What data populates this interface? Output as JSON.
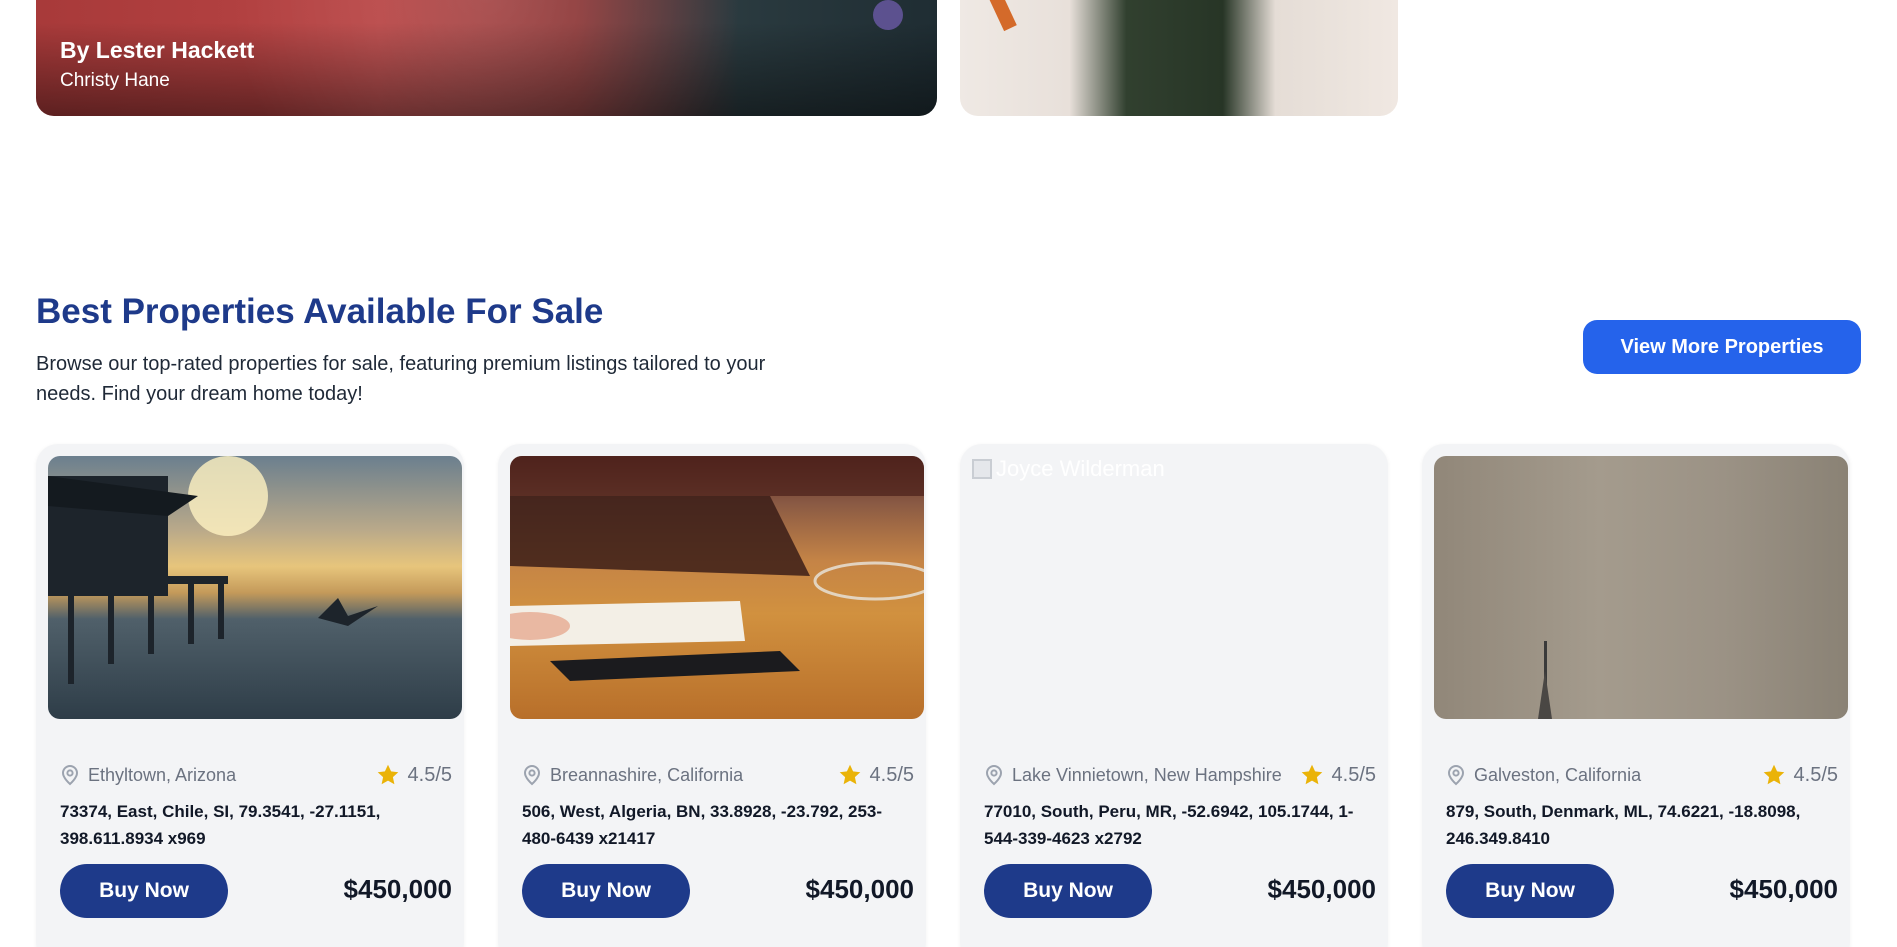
{
  "featured": [
    {
      "author": "By Lester Hackett",
      "subtitle": "Christy Hane"
    },
    {
      "author": "",
      "subtitle": ""
    }
  ],
  "section": {
    "title": "Best Properties Available For Sale",
    "description": "Browse our top-rated properties for sale, featuring premium listings tailored to your needs. Find your dream home today!",
    "view_more_label": "View More Properties"
  },
  "properties": [
    {
      "image_alt": "",
      "location": "Ethyltown, Arizona",
      "rating": "4.5/5",
      "address": "73374, East, Chile, SI, 79.3541, -27.1151, 398.611.8934 x969",
      "buy_label": "Buy Now",
      "price": "$450,000"
    },
    {
      "image_alt": "",
      "location": "Breannashire, California",
      "rating": "4.5/5",
      "address": "506, West, Algeria, BN, 33.8928, -23.792, 253-480-6439 x21417",
      "buy_label": "Buy Now",
      "price": "$450,000"
    },
    {
      "image_alt": "Joyce Wilderman",
      "location": "Lake Vinnietown, New Hampshire",
      "rating": "4.5/5",
      "address": "77010, South, Peru, MR, -52.6942, 105.1744, 1-544-339-4623 x2792",
      "buy_label": "Buy Now",
      "price": "$450,000"
    },
    {
      "image_alt": "",
      "location": "Galveston, California",
      "rating": "4.5/5",
      "address": "879, South, Denmark, ML, 74.6221, -18.8098, 246.349.8410",
      "buy_label": "Buy Now",
      "price": "$450,000"
    }
  ],
  "colors": {
    "title": "#1e3a8a",
    "primary_button": "#2563eb",
    "buy_button": "#1e3a8a",
    "star": "#eab308"
  },
  "icons": {
    "location": "map-pin-icon",
    "rating": "star-icon"
  }
}
